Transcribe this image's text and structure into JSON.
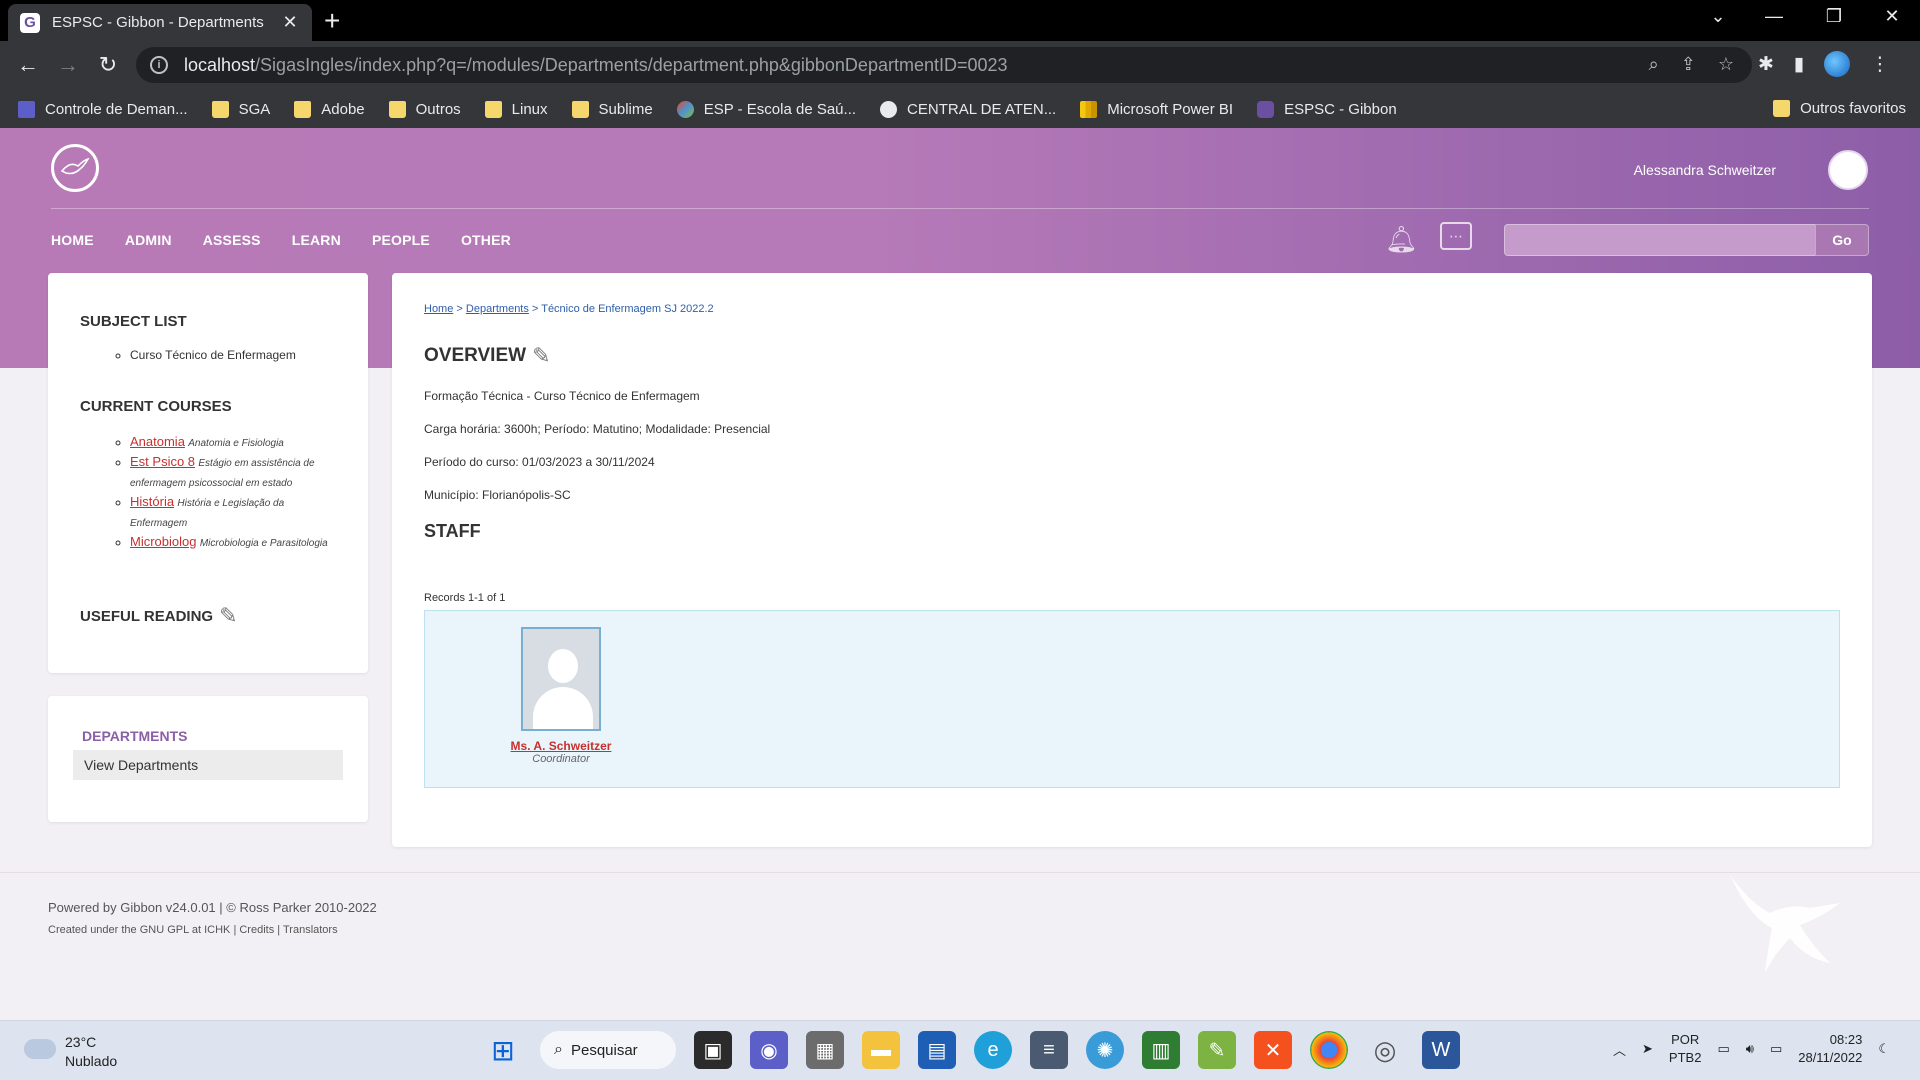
{
  "browser": {
    "tab_title": "ESPSC - Gibbon - Departments",
    "tab_favicon": "G",
    "url_host": "localhost",
    "url_path": "/SigasIngles/index.php?q=/modules/Departments/department.php&gibbonDepartmentID=0023",
    "bookmarks": [
      {
        "label": "Controle de Deman...",
        "icon": "list-icon",
        "color": "#5b5fc7"
      },
      {
        "label": "SGA",
        "icon": "folder-icon"
      },
      {
        "label": "Adobe",
        "icon": "folder-icon"
      },
      {
        "label": "Outros",
        "icon": "folder-icon"
      },
      {
        "label": "Linux",
        "icon": "folder-icon"
      },
      {
        "label": "Sublime",
        "icon": "folder-icon"
      },
      {
        "label": "ESP - Escola de Saú...",
        "icon": "joomla-icon",
        "color": "#e44d26"
      },
      {
        "label": "CENTRAL DE ATEN...",
        "icon": "globe-icon",
        "color": "#e8eaed"
      },
      {
        "label": "Microsoft Power BI",
        "icon": "powerbi-icon",
        "color": "#f2c811"
      },
      {
        "label": "ESPSC - Gibbon",
        "icon": "gibbon-icon",
        "color": "#6b4fa3"
      }
    ],
    "bookmarks_other": "Outros favoritos"
  },
  "header": {
    "user_name": "Alessandra Schweitzer",
    "nav": [
      "HOME",
      "ADMIN",
      "ASSESS",
      "LEARN",
      "PEOPLE",
      "OTHER"
    ],
    "search_go": "Go"
  },
  "sidebar": {
    "subject_list_title": "SUBJECT LIST",
    "subjects": [
      "Curso Técnico de Enfermagem"
    ],
    "current_courses_title": "CURRENT COURSES",
    "courses": [
      {
        "code": "Anatomia",
        "name": "Anatomia e Fisiologia"
      },
      {
        "code": "Est Psico 8",
        "name": "Estágio em assistência de enfermagem psicossocial em estado"
      },
      {
        "code": "História",
        "name": "História e Legislação da Enfermagem"
      },
      {
        "code": "Microbiolog",
        "name": "Microbiologia e Parasitologia"
      }
    ],
    "useful_reading_title": "USEFUL READING",
    "departments_title": "DEPARTMENTS",
    "view_departments": "View Departments"
  },
  "main": {
    "breadcrumb": {
      "home": "Home",
      "departments": "Departments",
      "current": "Técnico de Enfermagem SJ 2022.2"
    },
    "overview_title": "OVERVIEW",
    "info_lines": [
      "Formação Técnica - Curso Técnico de Enfermagem",
      "Carga horária: 3600h; Período: Matutino; Modalidade: Presencial",
      "Período do curso: 01/03/2023 a 30/11/2024",
      "Município: Florianópolis-SC"
    ],
    "staff_title": "STAFF",
    "records": "Records 1-1 of 1",
    "staff": [
      {
        "name": "Ms. A. Schweitzer",
        "role": "Coordinator"
      }
    ]
  },
  "footer": {
    "line1": "Powered by Gibbon v24.0.01 | © Ross Parker 2010-2022",
    "line2": "Created under the GNU GPL at ICHK | Credits | Translators"
  },
  "taskbar": {
    "temperature": "23°C",
    "weather": "Nublado",
    "search_label": "Pesquisar",
    "lang_1": "POR",
    "lang_2": "PTB2",
    "time": "08:23",
    "date": "28/11/2022"
  },
  "colors": {
    "header_purple": "#b77ab7",
    "link_red": "#c8302e",
    "dept_purple": "#8b5fa8"
  }
}
